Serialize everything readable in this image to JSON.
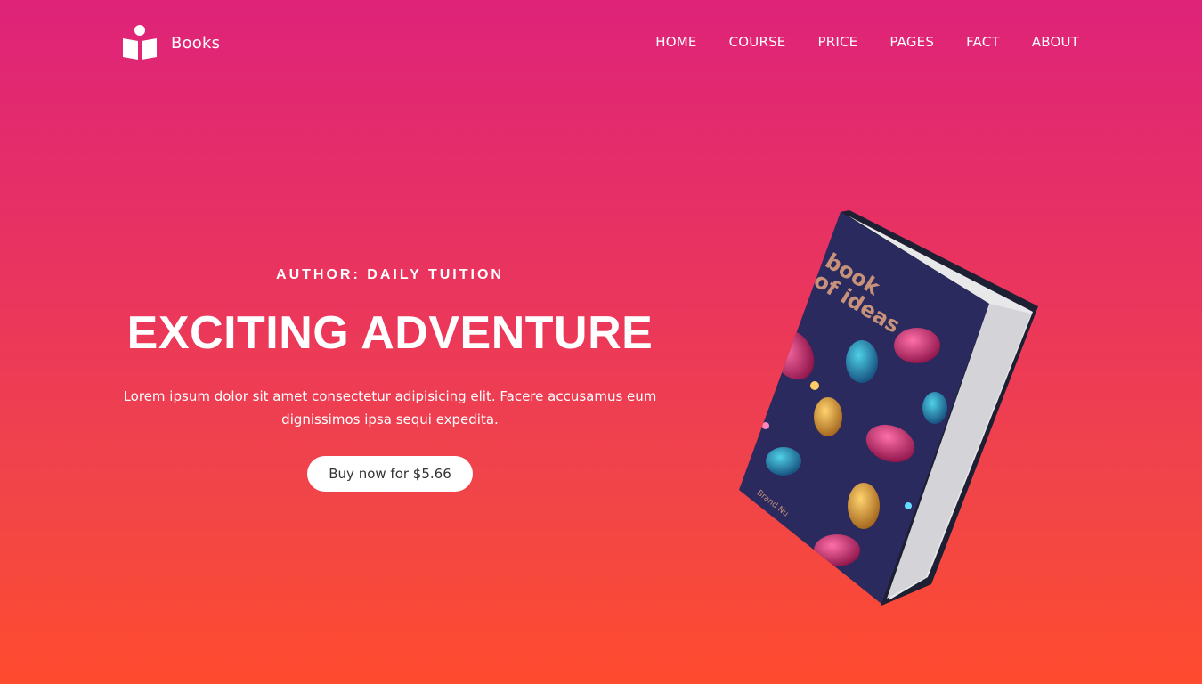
{
  "brand": {
    "name": "Books",
    "icon": "book-reader-icon"
  },
  "nav": {
    "items": [
      "HOME",
      "COURSE",
      "PRICE",
      "PAGES",
      "FACT",
      "ABOUT"
    ]
  },
  "hero": {
    "author": "AUTHOR: DAILY TUITION",
    "title": "EXCITING ADVENTURE",
    "description": "Lorem ipsum dolor sit amet consectetur adipisicing elit. Facere accusamus eum dignissimos ipsa sequi expedita.",
    "button_label": "Buy now for $5.66"
  },
  "book_cover": {
    "title_line1": "book",
    "title_line2": "of ideas",
    "brand": "Brand Nu"
  },
  "colors": {
    "gradient_top": "#de2379",
    "gradient_bottom": "#ff4b2e",
    "cover": "#2a2a5e"
  }
}
